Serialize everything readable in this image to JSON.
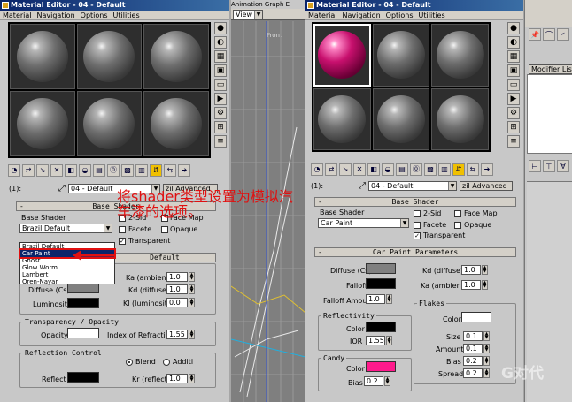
{
  "left_editor": {
    "title": "Material Editor - 04 - Default",
    "menu": [
      "Material",
      "Navigation",
      "Options",
      "Utilities"
    ],
    "name_number": "(1):",
    "material_name": "04 - Default",
    "shader_type_button": "zil Advanced",
    "rollout_shader": "Base Shader",
    "base_shader_label": "Base Shader",
    "base_shader_value": "Brazil Default",
    "two_sided": "2-Sid",
    "face_map": "Face Map",
    "faceted": "Facete",
    "opaque": "Opaque",
    "transparent": "Transparent",
    "rollout_params": "Default",
    "dropdown_items": [
      "Brazil Default",
      "Car Paint",
      "Ghost",
      "Glow Worm",
      "Lambert",
      "Oren-Nayar"
    ],
    "ka_ambient": {
      "label": "Ka (ambient)",
      "value": "1.0"
    },
    "kd_diffuse": {
      "label": "Kd (diffuse)",
      "value": "1.0"
    },
    "kl_luminosity": {
      "label": "Kl (luminosity)",
      "value": "0.0"
    },
    "diffuse_label": "Diffuse (Cs)",
    "luminosity_label": "Luminosity",
    "transparency_group": "Transparency / Opacity",
    "opacity_label": "Opacity",
    "index_refraction": {
      "label": "Index of Refraction",
      "value": "1.55"
    },
    "reflection_group": "Reflection Control",
    "blend": "Blend",
    "additive": "Additi",
    "reflect_label": "Reflect",
    "kr_reflect": {
      "label": "Kr (reflect)",
      "value": "1.0"
    }
  },
  "viewport": {
    "tabs": "Animation   Graph E",
    "view_label": "View",
    "front_label": "Front"
  },
  "right_editor": {
    "title": "Material Editor - 04 - Default",
    "menu": [
      "Material",
      "Navigation",
      "Options",
      "Utilities"
    ],
    "name_number": "(1):",
    "material_name": "04 - Default",
    "shader_type_button": "zil Advanced",
    "rollout_shader": "Base Shader",
    "base_shader_label": "Base Shader",
    "base_shader_value": "Car Paint",
    "two_sided": "2-Sid",
    "face_map": "Face Map",
    "faceted": "Facete",
    "opaque": "Opaque",
    "transparent": "Transparent",
    "rollout_params": "Car Paint Parameters",
    "diffuse_label": "Diffuse (Cs)",
    "falloff_label": "Falloff",
    "falloff_amount": {
      "label": "Falloff Amount",
      "value": "1.0"
    },
    "kd_diffuse": {
      "label": "Kd (diffuse)",
      "value": "1.0"
    },
    "ka_ambient": {
      "label": "Ka (ambient)",
      "value": "1.0"
    },
    "reflectivity_group": "Reflectivity",
    "reflectivity_color_label": "Color",
    "ior": {
      "label": "IOR",
      "value": "1.55"
    },
    "flakes_group": "Flakes",
    "flakes_color_label": "Color",
    "size": {
      "label": "Size",
      "value": "0.1"
    },
    "amount": {
      "label": "Amount",
      "value": "0.1"
    },
    "bias_flakes": {
      "label": "Bias",
      "value": "0.2"
    },
    "spread": {
      "label": "Spread",
      "value": "0.2"
    },
    "candy_group": "Candy",
    "candy_color_label": "Color",
    "bias_candy": {
      "label": "Bias",
      "value": "0.2"
    }
  },
  "modifier_panel": {
    "modifier_list_label": "Modifier List"
  },
  "annotation": "将shader类型设置为模拟汽车漆的选项。",
  "watermark": "G对代",
  "colors": {
    "title_bar": "#0a246a",
    "panel_bg": "#c8c8c8",
    "candy_color": "#ff1a8c",
    "annotation_red": "#e01010",
    "sample_selected": "#c8106e"
  }
}
